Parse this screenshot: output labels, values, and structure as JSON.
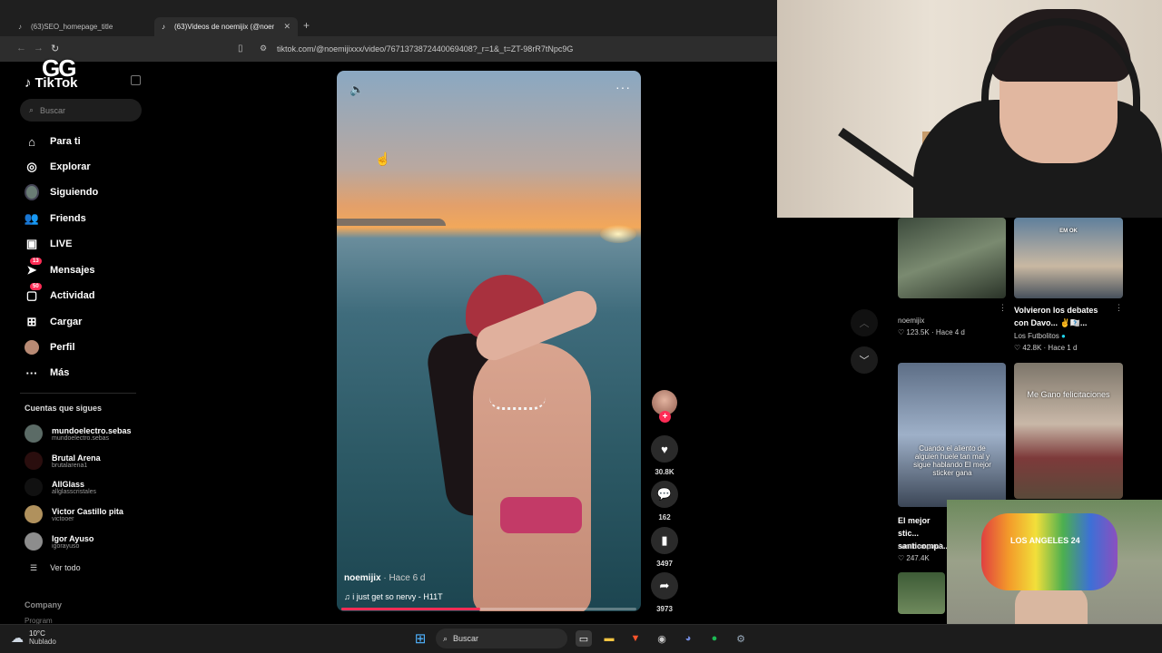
{
  "browser": {
    "tabs": [
      {
        "label": "(63)SEO_homepage_title"
      },
      {
        "label": "(63)Videos de noemijix (@noemi"
      }
    ],
    "url": "tiktok.com/@noemijixxx/video/7671373872440069408?_r=1&_t=ZT-98rR7tNpc9G"
  },
  "overlay": {
    "logo_text": "GG"
  },
  "sidebar": {
    "logo": "TikTok",
    "search_placeholder": "Buscar",
    "nav": [
      {
        "label": "Para ti",
        "icon": "home-icon"
      },
      {
        "label": "Explorar",
        "icon": "compass-icon"
      },
      {
        "label": "Siguiendo",
        "icon": "following-avatar-icon"
      },
      {
        "label": "Friends",
        "icon": "friends-icon"
      },
      {
        "label": "LIVE",
        "icon": "live-icon"
      },
      {
        "label": "Mensajes",
        "icon": "messages-icon",
        "badge": "13"
      },
      {
        "label": "Actividad",
        "icon": "activity-icon",
        "badge": "50"
      },
      {
        "label": "Cargar",
        "icon": "upload-icon"
      },
      {
        "label": "Perfil",
        "icon": "profile-icon"
      },
      {
        "label": "Más",
        "icon": "more-icon"
      }
    ],
    "following_title": "Cuentas que sigues",
    "following": [
      {
        "name": "mundoelectro.sebas",
        "handle": "mundoelectro.sebas"
      },
      {
        "name": "Brutal Arena",
        "handle": "brutalarena1"
      },
      {
        "name": "AllGlass",
        "handle": "allglasscristales"
      },
      {
        "name": "Victor Castillo pita",
        "handle": "victooer"
      },
      {
        "name": "Igor Ayuso",
        "handle": "igorayuso"
      }
    ],
    "see_all": "Ver todo",
    "footer_company": "Company",
    "footer_program": "Program"
  },
  "video": {
    "author": "noemijix",
    "posted": " · Hace 6 d",
    "music": "♫  i just get so nervy - H11T",
    "progress": 0.47
  },
  "actions": {
    "likes": "30.8K",
    "comments": "162",
    "saves": "3497",
    "shares": "3973"
  },
  "grid": {
    "items": [
      {
        "title": "",
        "author": "noemijix",
        "meta": "♡ 123.5K · Hace 4 d"
      },
      {
        "title": "Volvieron los debates con Davo... ✌️🇽🇽...",
        "author": "Los Futbolitos",
        "meta": "♡ 42.8K · Hace 1 d",
        "thumb_label": "EM OK"
      },
      {
        "title": "El mejor stic... santicompa...",
        "author": "santicompani",
        "meta": "♡ 247.4K",
        "thumb_text": "Cuando el aliento de alguien huele tan mal y sigue hablando El mejor sticker gana"
      },
      {
        "title": "",
        "author": "",
        "meta": "",
        "thumb_text": "Me Gano felicitaciones"
      }
    ]
  },
  "webcam2": {
    "shirt_text": "LOS ANGELES 24"
  },
  "taskbar": {
    "temp": "10°C",
    "condition": "Nublado",
    "search": "Buscar"
  },
  "colors": {
    "accent": "#fe2c55",
    "background": "#000000"
  }
}
